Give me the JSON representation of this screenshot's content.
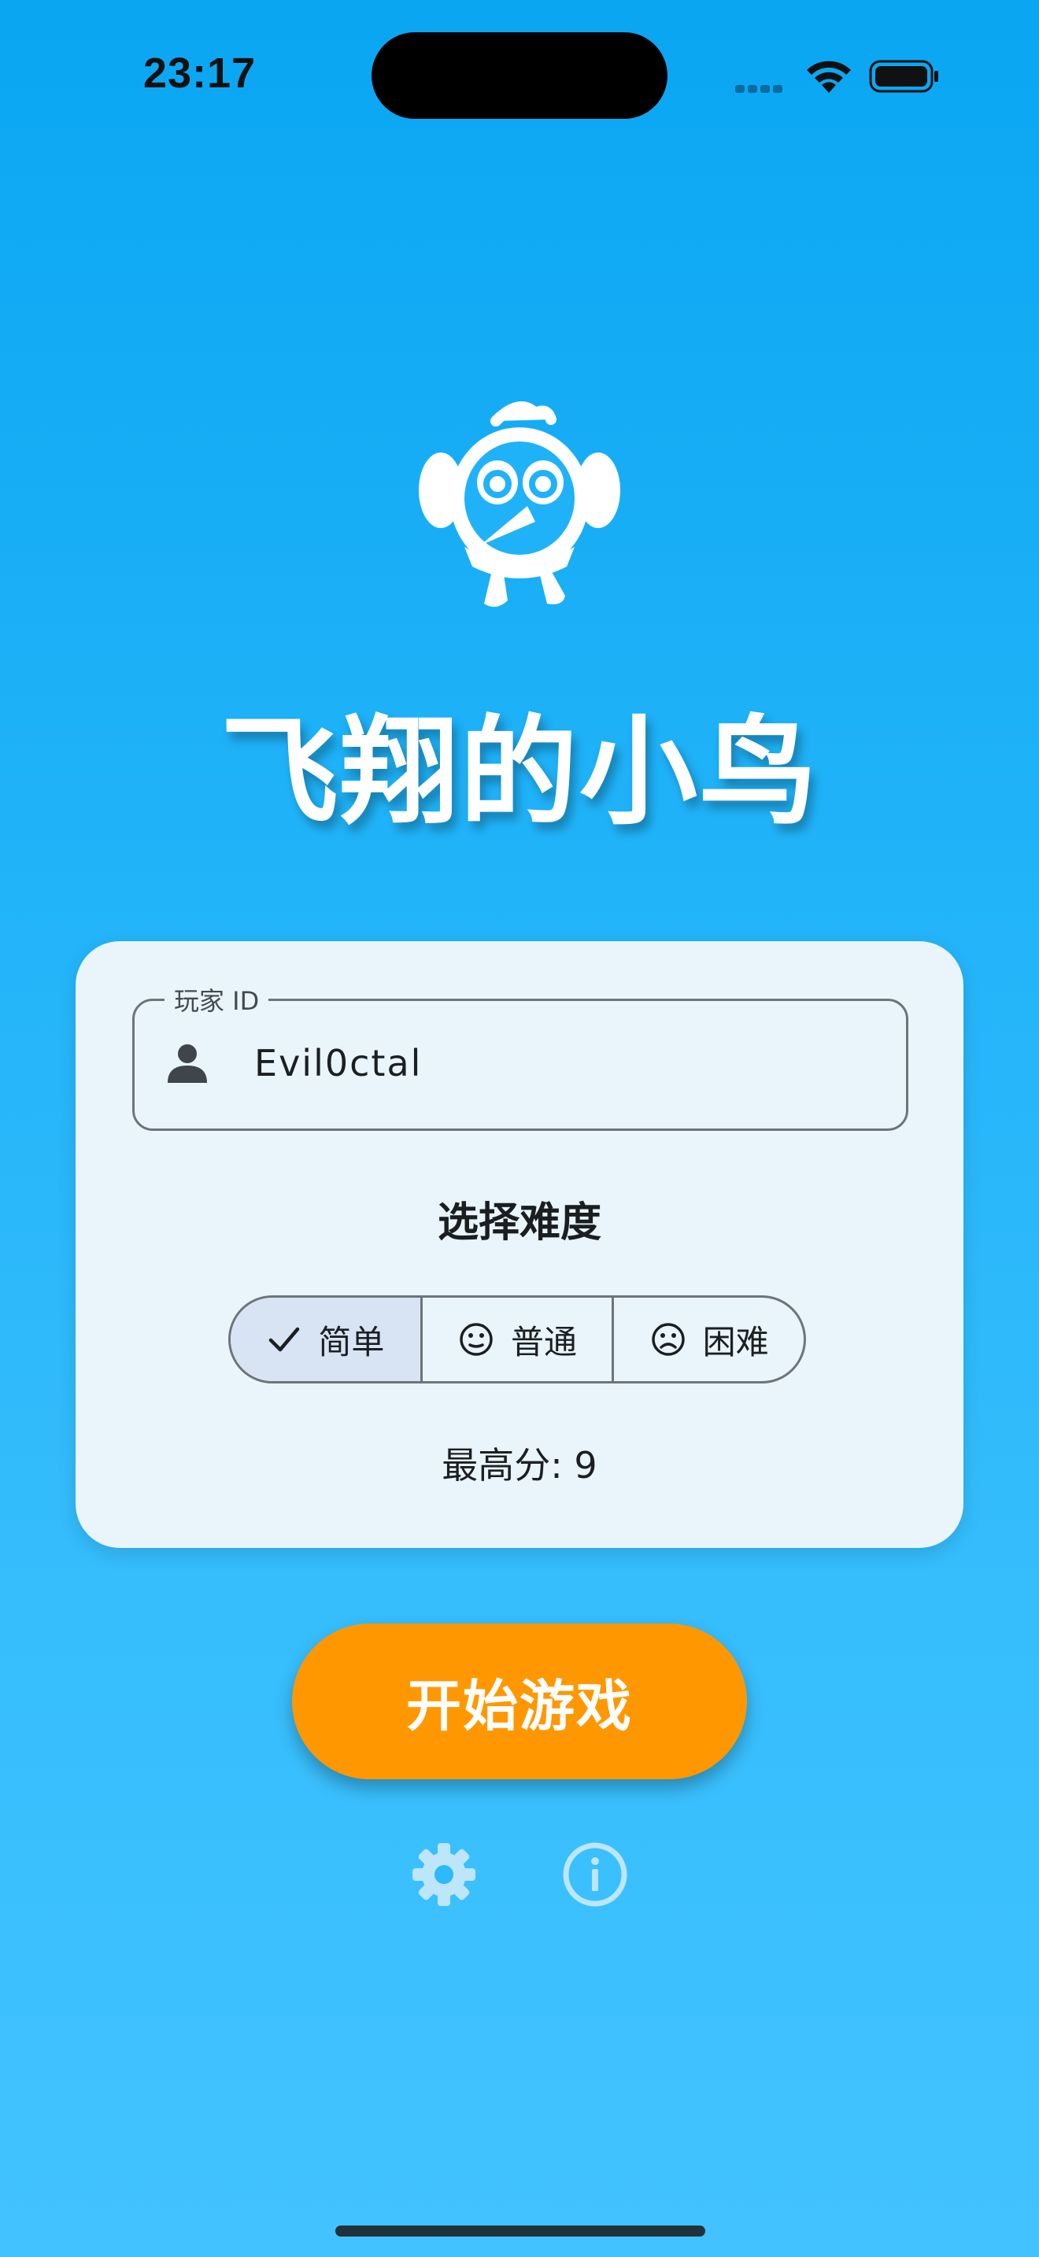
{
  "status_bar": {
    "time": "23:17",
    "icons": [
      "signal-icon",
      "wifi-icon",
      "battery-icon"
    ]
  },
  "app": {
    "logo_icon": "bird-logo-icon",
    "title": "飞翔的小鸟"
  },
  "card": {
    "player_id": {
      "label": "玩家 ID",
      "value": "Evil0ctal",
      "icon": "person-icon"
    },
    "difficulty": {
      "title": "选择难度",
      "options": [
        {
          "label": "简单",
          "icon": "check-icon",
          "selected": true
        },
        {
          "label": "普通",
          "icon": "neutral-face-icon",
          "selected": false
        },
        {
          "label": "困难",
          "icon": "sad-face-icon",
          "selected": false
        }
      ]
    },
    "high_score": "最高分: 9"
  },
  "actions": {
    "start_label": "开始游戏",
    "settings_icon": "gear-icon",
    "info_icon": "info-icon"
  },
  "colors": {
    "background_top": "#0aa6f2",
    "background_bottom": "#42c3ff",
    "card": "#e9f5fb",
    "start_button": "#ff9800",
    "selected_segment": "#d8e4f4"
  }
}
